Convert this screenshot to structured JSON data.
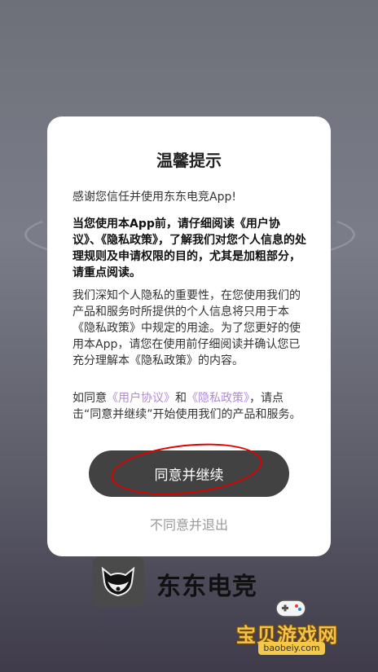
{
  "dialog": {
    "title": "温馨提示",
    "intro": "感谢您信任并使用东东电竞App!",
    "bold_paragraph": "当您使用本App前，请仔细阅读《用户协议》、《隐私政策》，了解我们对您个人信息的处理规则及申请权限的目的，尤其是加粗部分，请重点阅读。",
    "paragraph": "我们深知个人隐私的重要性，在您使用我们的产品和服务时所提供的个人信息将只用于本《隐私政策》中规定的用途。为了您更好的使用本App，请您在使用前仔细阅读并确认您已充分理解本《隐私政策》的内容。",
    "agree_prefix": "如同意",
    "user_agreement_link": "《用户协议》",
    "and_text": "和",
    "privacy_link": "《隐私政策》",
    "agree_suffix": "，请点击“同意并继续”开始使用我们的产品和服务。",
    "agree_button": "同意并继续",
    "decline_button": "不同意并退出"
  },
  "brand": {
    "name": "东东电竞"
  },
  "watermark": {
    "text": "宝贝游戏网",
    "url": "baobeiy.com"
  },
  "colors": {
    "link": "#b388d6",
    "button_bg": "#424242",
    "annotation": "#e00000"
  }
}
